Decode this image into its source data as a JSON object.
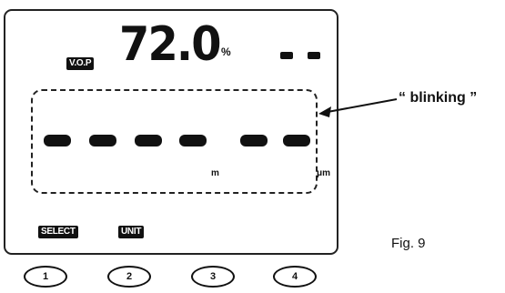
{
  "display": {
    "vop_label": "V.O.P",
    "main_value": "72.0",
    "main_unit": "%",
    "top_right_dashes": 2,
    "blink_segments": 6,
    "unit_m": "m",
    "unit_um": "μm",
    "select_label": "SELECT",
    "unit_label": "UNIT"
  },
  "buttons": [
    {
      "label": "1"
    },
    {
      "label": "2"
    },
    {
      "label": "3"
    },
    {
      "label": "4"
    }
  ],
  "callout": {
    "text": "“ blinking ”"
  },
  "figure": {
    "caption": "Fig. 9"
  }
}
